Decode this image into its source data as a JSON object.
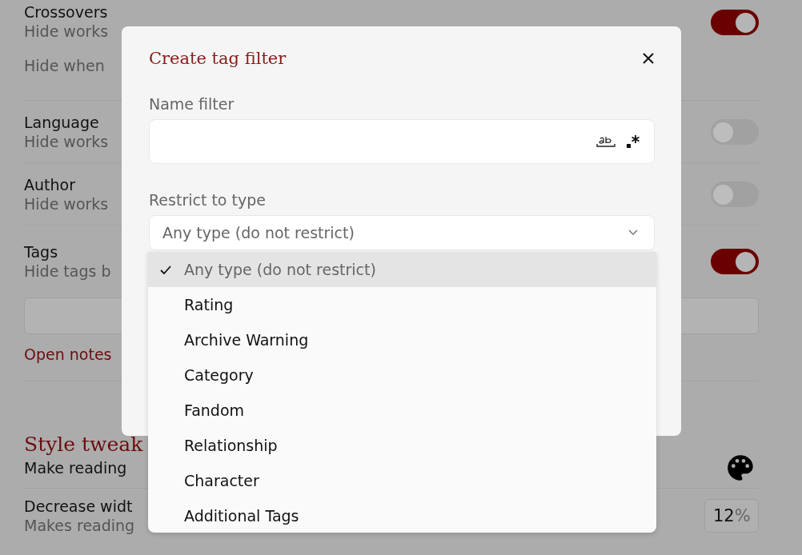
{
  "settings": [
    {
      "title": "Crossovers",
      "description": "Hide works",
      "note": "Hide when",
      "on": true
    },
    {
      "title": "Language",
      "description": "Hide works",
      "on": false
    },
    {
      "title": "Author",
      "description": "Hide works",
      "on": false
    },
    {
      "title": "Tags",
      "description": "Hide tags b",
      "on": true
    }
  ],
  "notes_link": "Open notes",
  "style_section": {
    "heading": "Style tweak",
    "description": "Make reading"
  },
  "width_setting": {
    "title": "Decrease widt",
    "description": "Makes reading",
    "value": "12",
    "unit": "%"
  },
  "dialog": {
    "title": "Create tag filter",
    "name_label": "Name filter",
    "type_label": "Restrict to type",
    "type_value": "Any type (do not restrict)",
    "options": [
      {
        "label": "Any type (do not restrict)",
        "selected": true
      },
      {
        "label": "Rating",
        "selected": false
      },
      {
        "label": "Archive Warning",
        "selected": false
      },
      {
        "label": "Category",
        "selected": false
      },
      {
        "label": "Fandom",
        "selected": false
      },
      {
        "label": "Relationship",
        "selected": false
      },
      {
        "label": "Character",
        "selected": false
      },
      {
        "label": "Additional Tags",
        "selected": false
      }
    ]
  }
}
